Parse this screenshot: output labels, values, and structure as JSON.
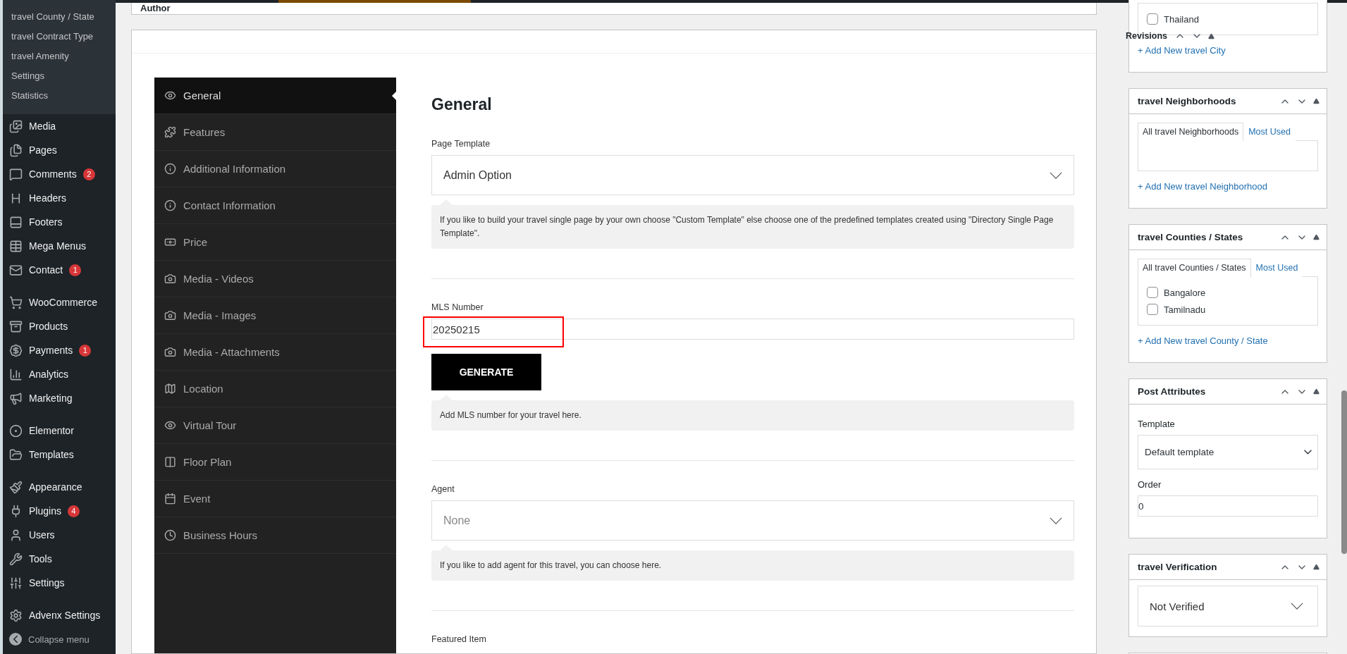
{
  "admin_menu": {
    "submenu": [
      {
        "label": "travel County / State"
      },
      {
        "label": "travel Contract Type"
      },
      {
        "label": "travel Amenity"
      },
      {
        "label": "Settings"
      },
      {
        "label": "Statistics"
      }
    ],
    "groups": [
      [
        {
          "label": "Media"
        },
        {
          "label": "Pages"
        },
        {
          "label": "Comments",
          "badge": "2"
        },
        {
          "label": "Headers"
        },
        {
          "label": "Footers"
        },
        {
          "label": "Mega Menus"
        },
        {
          "label": "Contact",
          "badge": "1"
        }
      ],
      [
        {
          "label": "WooCommerce"
        },
        {
          "label": "Products"
        },
        {
          "label": "Payments",
          "badge": "1"
        },
        {
          "label": "Analytics"
        },
        {
          "label": "Marketing"
        }
      ],
      [
        {
          "label": "Elementor"
        },
        {
          "label": "Templates"
        }
      ],
      [
        {
          "label": "Appearance"
        },
        {
          "label": "Plugins",
          "badge": "4"
        },
        {
          "label": "Users"
        },
        {
          "label": "Tools"
        },
        {
          "label": "Settings"
        }
      ],
      [
        {
          "label": "Advenx Settings"
        }
      ]
    ],
    "collapse": "Collapse menu"
  },
  "author_panel": {
    "title": "Author"
  },
  "revisions": {
    "label": "Revisions"
  },
  "options_tabs": [
    {
      "label": "General",
      "selected": true
    },
    {
      "label": "Features",
      "selected": false
    },
    {
      "label": "Additional Information",
      "selected": false
    },
    {
      "label": "Contact Information",
      "selected": false
    },
    {
      "label": "Price",
      "selected": false
    },
    {
      "label": "Media - Videos",
      "selected": false
    },
    {
      "label": "Media - Images",
      "selected": false
    },
    {
      "label": "Media - Attachments",
      "selected": false
    },
    {
      "label": "Location",
      "selected": false
    },
    {
      "label": "Virtual Tour",
      "selected": false
    },
    {
      "label": "Floor Plan",
      "selected": false
    },
    {
      "label": "Event",
      "selected": false
    },
    {
      "label": "Business Hours",
      "selected": false
    }
  ],
  "content": {
    "heading": "General",
    "sections": [
      {
        "kind": "select",
        "label": "Page Template",
        "value": "Admin Option",
        "hint": "If you like to build your travel single page by your own choose \"Custom Template\" else choose one of the predefined templates created using \"Directory Single Page Template\"."
      },
      {
        "kind": "generator",
        "label": "MLS Number",
        "value": "20250215",
        "highlighted": true,
        "button": "GENERATE",
        "hint": "Add MLS number for your travel here."
      },
      {
        "kind": "select",
        "label": "Agent",
        "placeholder": "None",
        "hint": "If you like to add agent for this travel, you can choose here."
      },
      {
        "kind": "label",
        "label": "Featured Item"
      }
    ]
  },
  "side_boxes": [
    {
      "kind": "taxonomy",
      "items": [
        {
          "label": "Thailand",
          "checked": false
        }
      ],
      "add_link": "+ Add New travel City"
    },
    {
      "kind": "taxonomy",
      "title": "travel Neighborhoods",
      "tabs": [
        {
          "label": "All travel Neighborhoods",
          "selected": true
        },
        {
          "label": "Most Used",
          "selected": false
        }
      ],
      "add_link": "+ Add New travel Neighborhood"
    },
    {
      "kind": "taxonomy",
      "title": "travel Counties / States",
      "tabs": [
        {
          "label": "All travel Counties / States",
          "selected": true
        },
        {
          "label": "Most Used",
          "selected": false
        }
      ],
      "items": [
        {
          "label": "Bangalore",
          "checked": false
        },
        {
          "label": "Tamilnadu",
          "checked": false
        }
      ],
      "add_link": "+ Add New travel County / State"
    },
    {
      "kind": "attributes",
      "title": "Post Attributes",
      "template_label": "Template",
      "template_value": "Default template",
      "order_label": "Order",
      "order_value": "0"
    },
    {
      "kind": "select",
      "title": "travel Verification",
      "value": "Not Verified"
    },
    {
      "kind": "empty"
    }
  ]
}
